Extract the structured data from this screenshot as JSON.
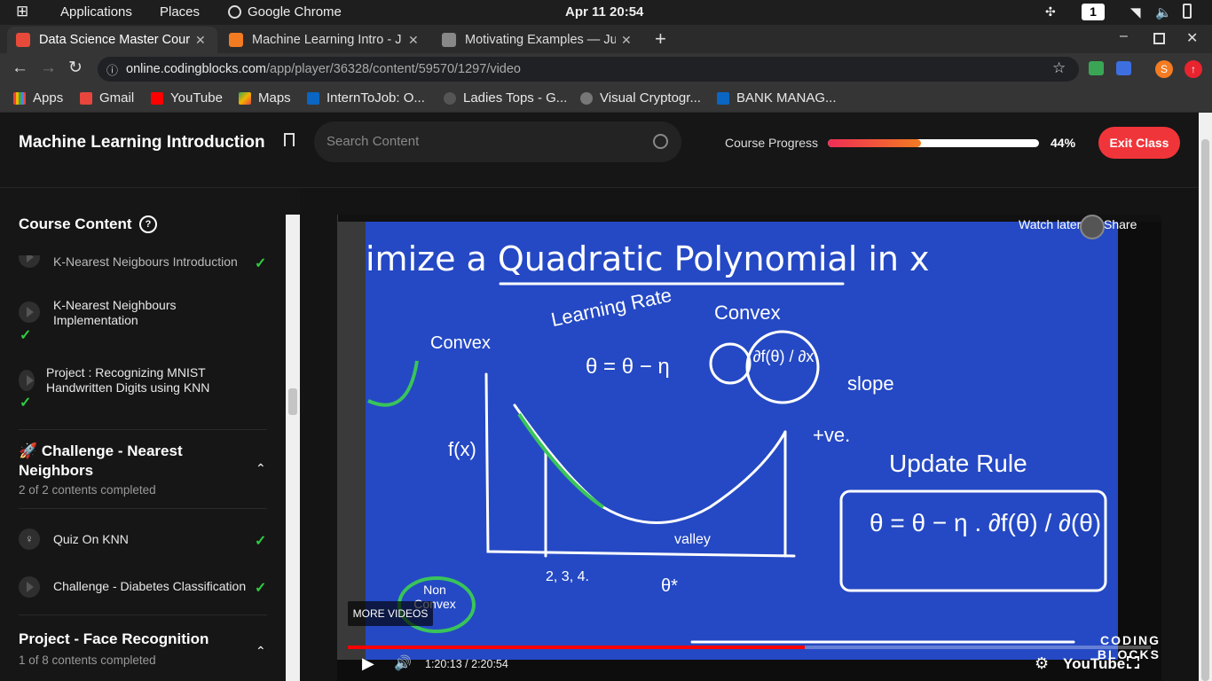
{
  "system": {
    "applications": "Applications",
    "places": "Places",
    "browser": "Google Chrome",
    "clock": "Apr 11  20:54",
    "workspace": "1"
  },
  "tabs": [
    {
      "title": "Data Science Master Cour",
      "active": true
    },
    {
      "title": "Machine Learning Intro - J",
      "active": false
    },
    {
      "title": "Motivating Examples — Ju",
      "active": false
    }
  ],
  "address": {
    "domain": "online.codingblocks.com",
    "path": "/app/player/36328/content/59570/1297/video",
    "profile_initial": "S"
  },
  "bookmarks": [
    "Apps",
    "Gmail",
    "YouTube",
    "Maps",
    "InternToJob: O...",
    "Ladies Tops - G...",
    "Visual Cryptogr...",
    "BANK MANAG..."
  ],
  "header": {
    "title": "Machine Learning Introduction",
    "search_placeholder": "Search Content",
    "progress_label": "Course Progress",
    "progress_value": 0.44,
    "progress_text": "44%",
    "exit_label": "Exit Class"
  },
  "sidebar": {
    "title": "Course Content",
    "items": [
      {
        "label": "K-Nearest Neigbours Introduction",
        "done": true
      },
      {
        "label": "K-Nearest Neighbours Implementation",
        "done": true
      },
      {
        "label": "Project : Recognizing MNIST Handwritten Digits using KNN",
        "done": true
      }
    ],
    "section1": {
      "title": "🚀 Challenge - Nearest Neighbors",
      "progress": "2 of 2 contents completed"
    },
    "section1_items": [
      {
        "label": "Quiz On KNN",
        "done": true
      },
      {
        "label": "Challenge - Diabetes Classification",
        "done": true
      }
    ],
    "section2": {
      "title": "Project - Face Recognition",
      "progress": "1 of 8 contents completed"
    }
  },
  "video": {
    "board_title": "imize a Quadratic Polynomial in x",
    "watch_later": "Watch later",
    "share": "Share",
    "more_videos": "MORE VIDEOS",
    "time": "1:20:13 / 2:20:54",
    "played_fraction": 0.569,
    "youtube_label": "YouTube",
    "watermark": "CODING BLOCKS",
    "handwriting": {
      "learning_rate": "Learning Rate",
      "convex_top": "Convex",
      "convex_left": "Convex",
      "eq": "θ = θ − η",
      "partial": "∂f(θ) / ∂x",
      "slope": "slope",
      "tve": "+ve.",
      "fx": "f(x)",
      "update_rule": "Update Rule",
      "update_eq": "θ = θ − η . ∂f(θ) / ∂(θ)",
      "valley": "valley",
      "non_convex": "Non Convex",
      "theta_star": "θ*",
      "iters": "2, 3, 4."
    }
  }
}
